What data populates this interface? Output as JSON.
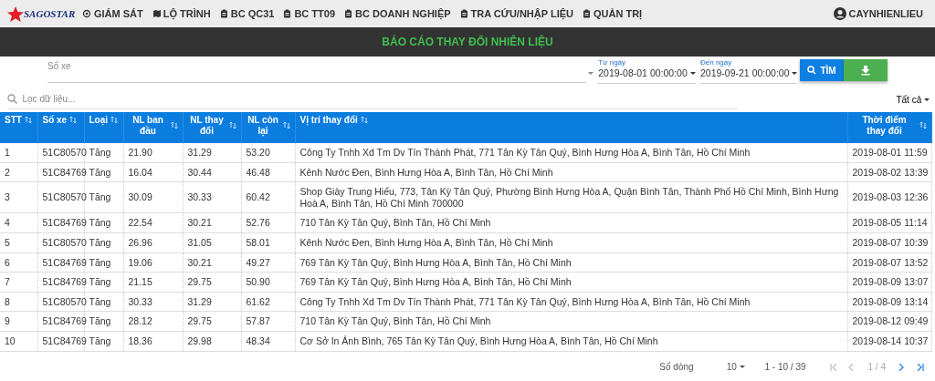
{
  "navbar": {
    "logo": "SAGOSTAR",
    "items": [
      {
        "label": "GIÁM SÁT"
      },
      {
        "label": "LỘ TRÌNH"
      },
      {
        "label": "BC QC31"
      },
      {
        "label": "BC TT09"
      },
      {
        "label": "BC DOANH NGHIỆP"
      },
      {
        "label": "TRA CỨU/NHẬP LIỆU"
      },
      {
        "label": "QUẢN TRỊ"
      }
    ],
    "user": "CAYNHIENLIEU"
  },
  "title": "BÁO CÁO THAY ĐỔI NHIÊN LIỆU",
  "filters": {
    "vehicle": {
      "placeholder": "Số xe"
    },
    "from": {
      "label": "Từ ngày",
      "value": "2019-08-01 00:00:00"
    },
    "to": {
      "label": "Đến ngày",
      "value": "2019-09-21 00:00:00"
    },
    "search_button": "TÌM"
  },
  "filter_bar": {
    "placeholder": "Lọc dữ liệu...",
    "scope": "Tất cả"
  },
  "table": {
    "columns": [
      {
        "label": "STT"
      },
      {
        "label": "Số xe"
      },
      {
        "label": "Loại"
      },
      {
        "label": "NL ban đầu"
      },
      {
        "label": "NL thay đổi"
      },
      {
        "label": "NL còn lại"
      },
      {
        "label": "Vị trí thay đổi"
      },
      {
        "label": "Thời điểm thay đổi"
      }
    ],
    "rows": [
      [
        "1",
        "51C80570",
        "Tăng",
        "21.90",
        "31.29",
        "53.20",
        "Công Ty Tnhh Xd Tm Dv Tín Thành Phát, 771 Tân Kỳ Tân Quý, Bình Hưng Hòa A, Bình Tân, Hồ Chí Minh",
        "2019-08-01 11:59"
      ],
      [
        "2",
        "51C84769",
        "Tăng",
        "16.04",
        "30.44",
        "46.48",
        "Kênh Nước Đen, Bình Hưng Hòa A, Bình Tân, Hồ Chí Minh",
        "2019-08-02 13:39"
      ],
      [
        "3",
        "51C80570",
        "Tăng",
        "30.09",
        "30.33",
        "60.42",
        "Shop Giày Trung Hiếu, 773, Tân Kỳ Tân Quý, Phường Bình Hưng Hòa A, Quận Bình Tân, Thành Phố Hồ Chí Minh, Bình Hưng Hoà A, Bình Tân, Hồ Chí Minh 700000",
        "2019-08-03 12:36"
      ],
      [
        "4",
        "51C84769",
        "Tăng",
        "22.54",
        "30.21",
        "52.76",
        "710 Tân Kỳ Tân Quý, Bình Tân, Hồ Chí Minh",
        "2019-08-05 11:14"
      ],
      [
        "5",
        "51C80570",
        "Tăng",
        "26.96",
        "31.05",
        "58.01",
        "Kênh Nước Đen, Bình Hưng Hòa A, Bình Tân, Hồ Chí Minh",
        "2019-08-07 10:39"
      ],
      [
        "6",
        "51C84769",
        "Tăng",
        "19.06",
        "30.21",
        "49.27",
        "769 Tân Kỳ Tân Quý, Bình Hưng Hòa A, Bình Tân, Hồ Chí Minh",
        "2019-08-07 13:52"
      ],
      [
        "7",
        "51C84769",
        "Tăng",
        "21.15",
        "29.75",
        "50.90",
        "769 Tân Kỳ Tân Quý, Bình Hưng Hòa A, Bình Tân, Hồ Chí Minh",
        "2019-08-09 13:07"
      ],
      [
        "8",
        "51C80570",
        "Tăng",
        "30.33",
        "31.29",
        "61.62",
        "Công Ty Tnhh Xd Tm Dv Tín Thành Phát, 771 Tân Kỳ Tân Quý, Bình Hưng Hòa A, Bình Tân, Hồ Chí Minh",
        "2019-08-09 13:14"
      ],
      [
        "9",
        "51C84769",
        "Tăng",
        "28.12",
        "29.75",
        "57.87",
        "710 Tân Kỳ Tân Quý, Bình Tân, Hồ Chí Minh",
        "2019-08-12 09:49"
      ],
      [
        "10",
        "51C84769",
        "Tăng",
        "18.36",
        "29.98",
        "48.34",
        "Cơ Sở In Ảnh Bình, 765 Tân Kỳ Tân Quý, Bình Hưng Hòa A, Bình Tân, Hồ Chí Minh",
        "2019-08-14 10:37"
      ]
    ]
  },
  "footer": {
    "rows_label": "Số dòng",
    "page_size": "10",
    "range": "1 - 10 / 39",
    "page": "1 / 4",
    "pager": [
      {
        "disabled": true
      },
      {
        "disabled": true
      },
      {
        "disabled": false
      },
      {
        "disabled": false
      }
    ]
  }
}
